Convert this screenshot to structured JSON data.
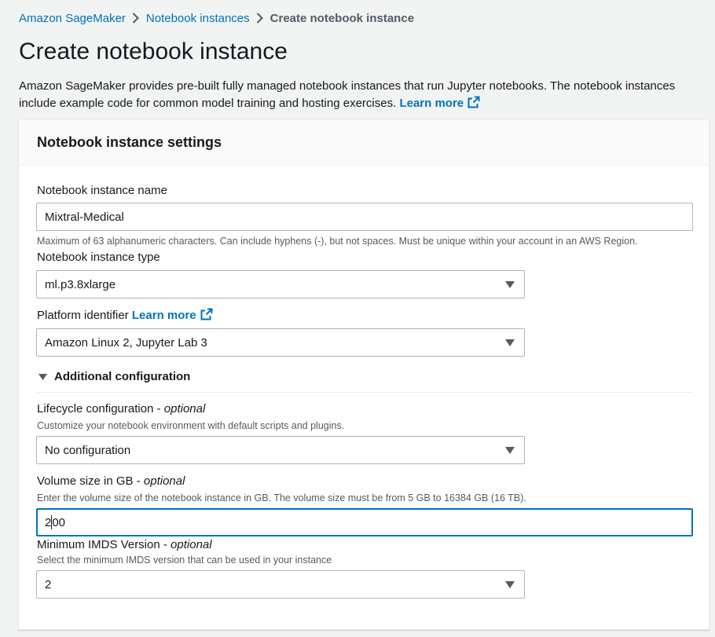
{
  "breadcrumb": {
    "items": [
      "Amazon SageMaker",
      "Notebook instances"
    ],
    "current": "Create notebook instance"
  },
  "page": {
    "title": "Create notebook instance",
    "description": "Amazon SageMaker provides pre-built fully managed notebook instances that run Jupyter notebooks. The notebook instances include example code for common model training and hosting exercises.",
    "learn_more": "Learn more"
  },
  "panel": {
    "title": "Notebook instance settings",
    "name_field": {
      "label": "Notebook instance name",
      "value": "Mixtral-Medical",
      "hint": "Maximum of 63 alphanumeric characters. Can include hyphens (-), but not spaces. Must be unique within your account in an AWS Region."
    },
    "type_field": {
      "label": "Notebook instance type",
      "value": "ml.p3.8xlarge"
    },
    "platform_field": {
      "label": "Platform identifier",
      "learn_more": "Learn more",
      "value": "Amazon Linux 2, Jupyter Lab 3"
    },
    "additional": {
      "label": "Additional configuration",
      "lifecycle": {
        "label": "Lifecycle configuration",
        "optional": "optional",
        "hint": "Customize your notebook environment with default scripts and plugins.",
        "value": "No configuration"
      },
      "volume": {
        "label": "Volume size in GB",
        "optional": "optional",
        "hint": "Enter the volume size of the notebook instance in GB. The volume size must be from 5 GB to 16384 GB (16 TB).",
        "value_before_cursor": "2",
        "value_after_cursor": "00"
      },
      "imds": {
        "label": "Minimum IMDS Version",
        "optional": "optional",
        "hint": "Select the minimum IMDS version that can be used in your instance",
        "value": "2"
      }
    }
  },
  "colors": {
    "link": "#0073bb",
    "focus_border": "#0073bb",
    "background": "#f2f3f3"
  }
}
